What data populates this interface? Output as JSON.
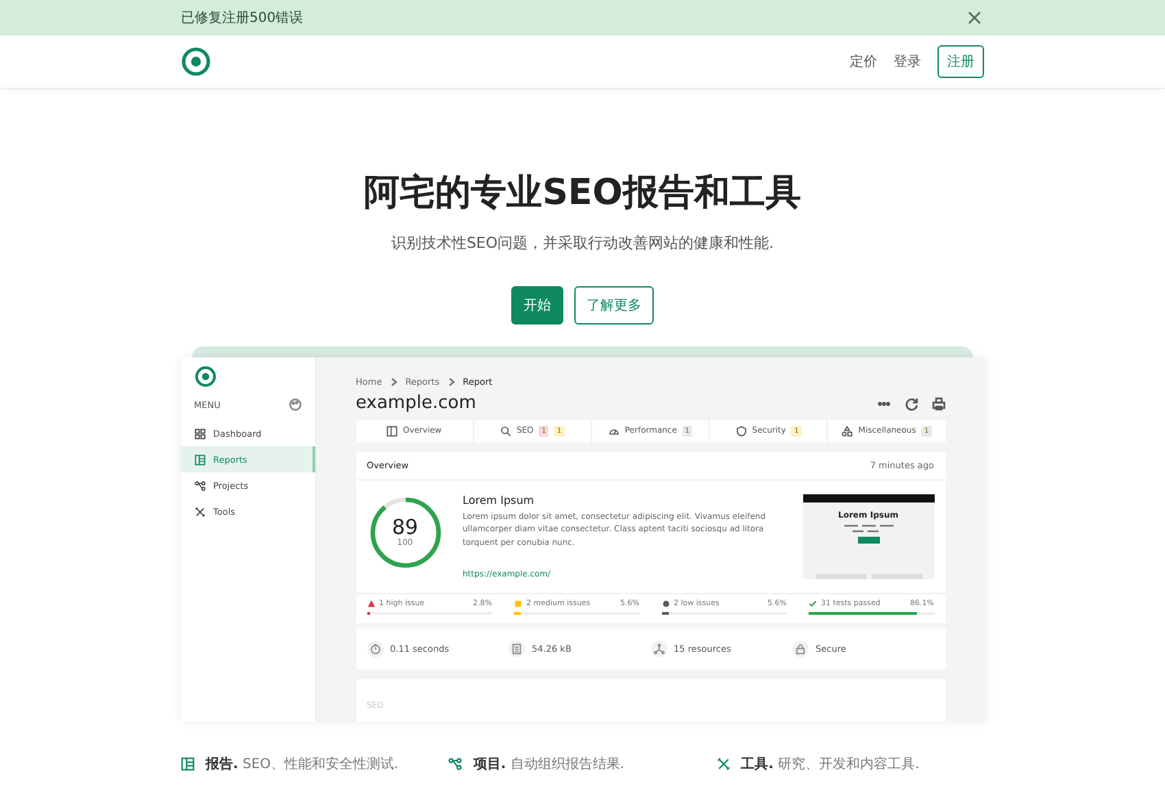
{
  "banner": {
    "text": "已修复注册500错误"
  },
  "nav": {
    "links": [
      "定价",
      "登录"
    ],
    "signup": "注册"
  },
  "hero": {
    "title": "阿宅的专业SEO报告和工具",
    "subtitle": "识别技术性SEO问题，并采取行动改善网站的健康和性能.",
    "buttons": [
      {
        "label": "开始",
        "kind": "primary"
      },
      {
        "label": "了解更多",
        "kind": "outline"
      }
    ]
  },
  "preview": {
    "sidebar": {
      "menu_label": "MENU",
      "items": [
        {
          "label": "Dashboard",
          "kind": "grid",
          "selected": false
        },
        {
          "label": "Reports",
          "kind": "report",
          "selected": true
        },
        {
          "label": "Projects",
          "kind": "projects",
          "selected": false
        },
        {
          "label": "Tools",
          "kind": "tools",
          "selected": false
        }
      ]
    },
    "breadcrumb": [
      "Home",
      "Reports",
      "Report"
    ],
    "title": "example.com",
    "tabs": [
      {
        "label": "Overview",
        "kind": "overview"
      },
      {
        "label": "SEO",
        "kind": "search",
        "badges": [
          {
            "text": "1",
            "color": "#f8d7da"
          },
          {
            "text": "1",
            "color": "#fff1c2"
          }
        ]
      },
      {
        "label": "Performance",
        "kind": "gauge",
        "badges": [
          {
            "text": "1",
            "color": "#e9e9e9"
          }
        ]
      },
      {
        "label": "Security",
        "kind": "shield",
        "badges": [
          {
            "text": "1",
            "color": "#fff1c2"
          }
        ]
      },
      {
        "label": "Miscellaneous",
        "kind": "shapes",
        "badges": [
          {
            "text": "1",
            "color": "#e9e9e9"
          }
        ]
      }
    ],
    "overview": {
      "heading": "Overview",
      "time": "7 minutes ago",
      "score": "89",
      "score_max": "100",
      "level": 0.89,
      "site_title": "Lorem Ipsum",
      "description": "Lorem ipsum dolor sit amet, consectetur adipiscing elit. Vivamus eleifend ullamcorper diam vitae consectetur. Class aptent taciti sociosqu ad litora torquent per conubia nunc.",
      "url": "https://example.com/",
      "thumbnail_title": "Lorem Ipsum",
      "issues": [
        {
          "kind": "high",
          "label": "1 high issue",
          "percent": "2.8%",
          "level": 0.028,
          "color": "#dc3545"
        },
        {
          "kind": "medium",
          "label": "2 medium issues",
          "percent": "5.6%",
          "level": 0.056,
          "color": "#ffc107"
        },
        {
          "kind": "low",
          "label": "2 low issues",
          "percent": "5.6%",
          "level": 0.056,
          "color": "#5c5c5c"
        },
        {
          "kind": "passed",
          "label": "31 tests passed",
          "percent": "86.1%",
          "level": 0.861,
          "color": "#28a745"
        }
      ],
      "stats": [
        {
          "kind": "time",
          "text": "0.11 seconds"
        },
        {
          "kind": "size",
          "text": "54.26 kB"
        },
        {
          "kind": "resources",
          "text": "15 resources"
        },
        {
          "kind": "secure",
          "text": "Secure"
        }
      ]
    },
    "next_section": "SEO"
  },
  "features": [
    {
      "kind": "report",
      "title": "报告.",
      "text": "SEO、性能和安全性测试."
    },
    {
      "kind": "projects",
      "title": "项目.",
      "text": "自动组织报告结果."
    },
    {
      "kind": "tools",
      "title": "工具.",
      "text": "研究、开发和内容工具."
    }
  ]
}
